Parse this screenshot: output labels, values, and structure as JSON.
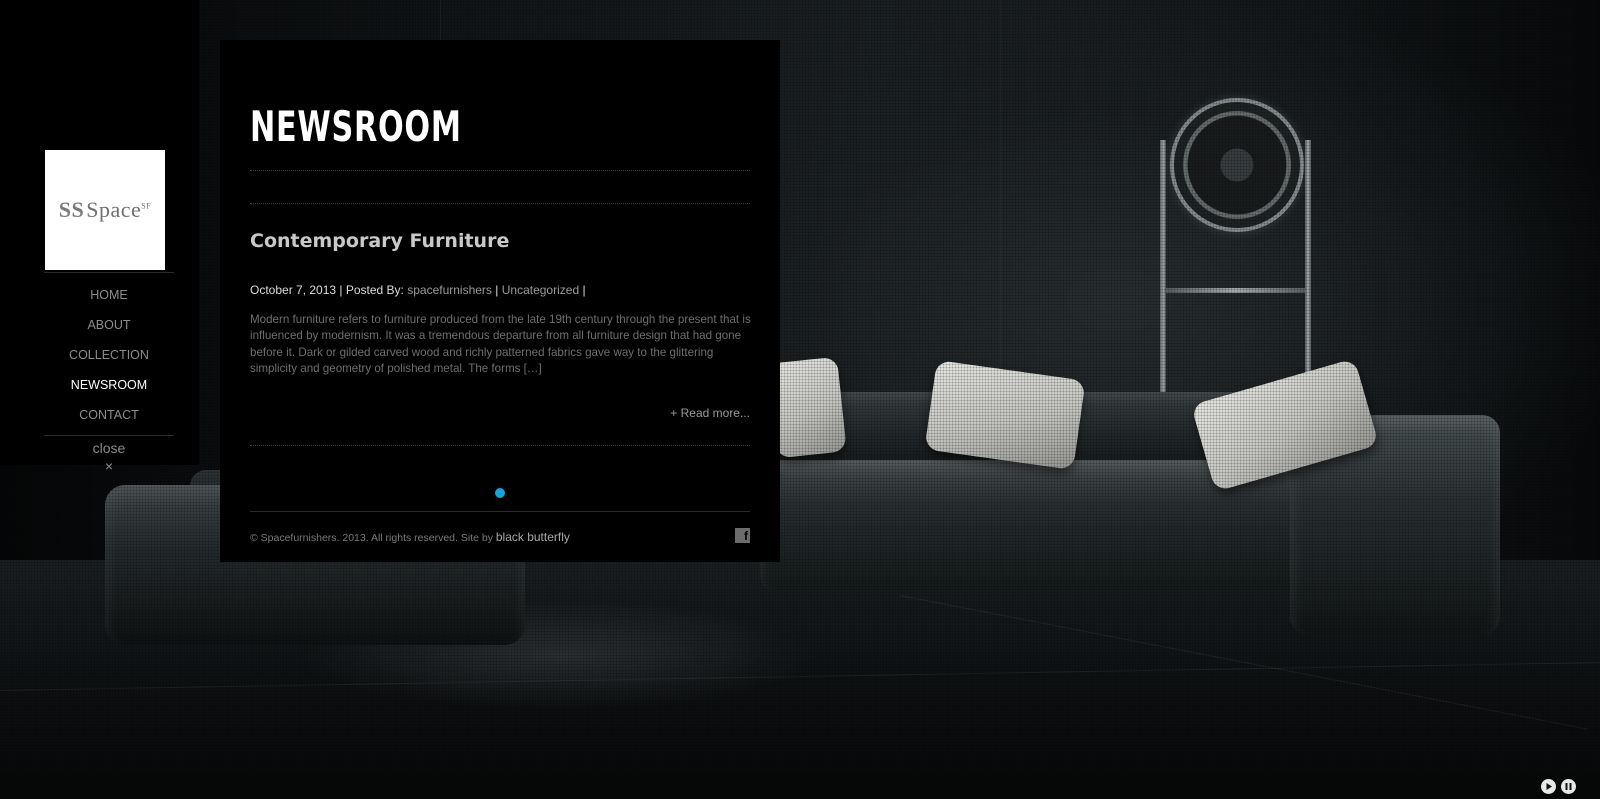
{
  "logo": {
    "text": "Space",
    "mark": "SS",
    "sup": "SF"
  },
  "nav": {
    "items": [
      {
        "label": "HOME"
      },
      {
        "label": "ABOUT"
      },
      {
        "label": "COLLECTION"
      },
      {
        "label": "NEWSROOM",
        "active": true
      },
      {
        "label": "CONTACT"
      }
    ],
    "close_label": "close",
    "close_glyph": "×"
  },
  "page": {
    "title": "NEWSROOM"
  },
  "post": {
    "title": "Contemporary Furniture",
    "date": "October 7, 2013",
    "sep1": " | Posted By: ",
    "author": "spacefurnishers",
    "sep2": " | ",
    "category": "Uncategorized",
    "sep3": " |",
    "excerpt": "Modern furniture refers to furniture produced from the late 19th century through the present that is influenced by modernism. It was a tremendous departure from all furniture design that had gone before it. Dark or gilded carved wood and richly patterned fabrics gave way to the glittering simplicity and geometry of polished metal. The forms […]",
    "read_more": "+ Read more..."
  },
  "footer": {
    "copyright": "© Spacefurnishers. 2013. All rights reserved. Site by ",
    "credit": "black butterfly",
    "social_icon": "facebook-icon",
    "social_glyph": "f"
  },
  "media_controls": [
    "play-icon",
    "pause-icon"
  ],
  "colors": {
    "accent": "#10a6dc",
    "panel": "#000000"
  }
}
